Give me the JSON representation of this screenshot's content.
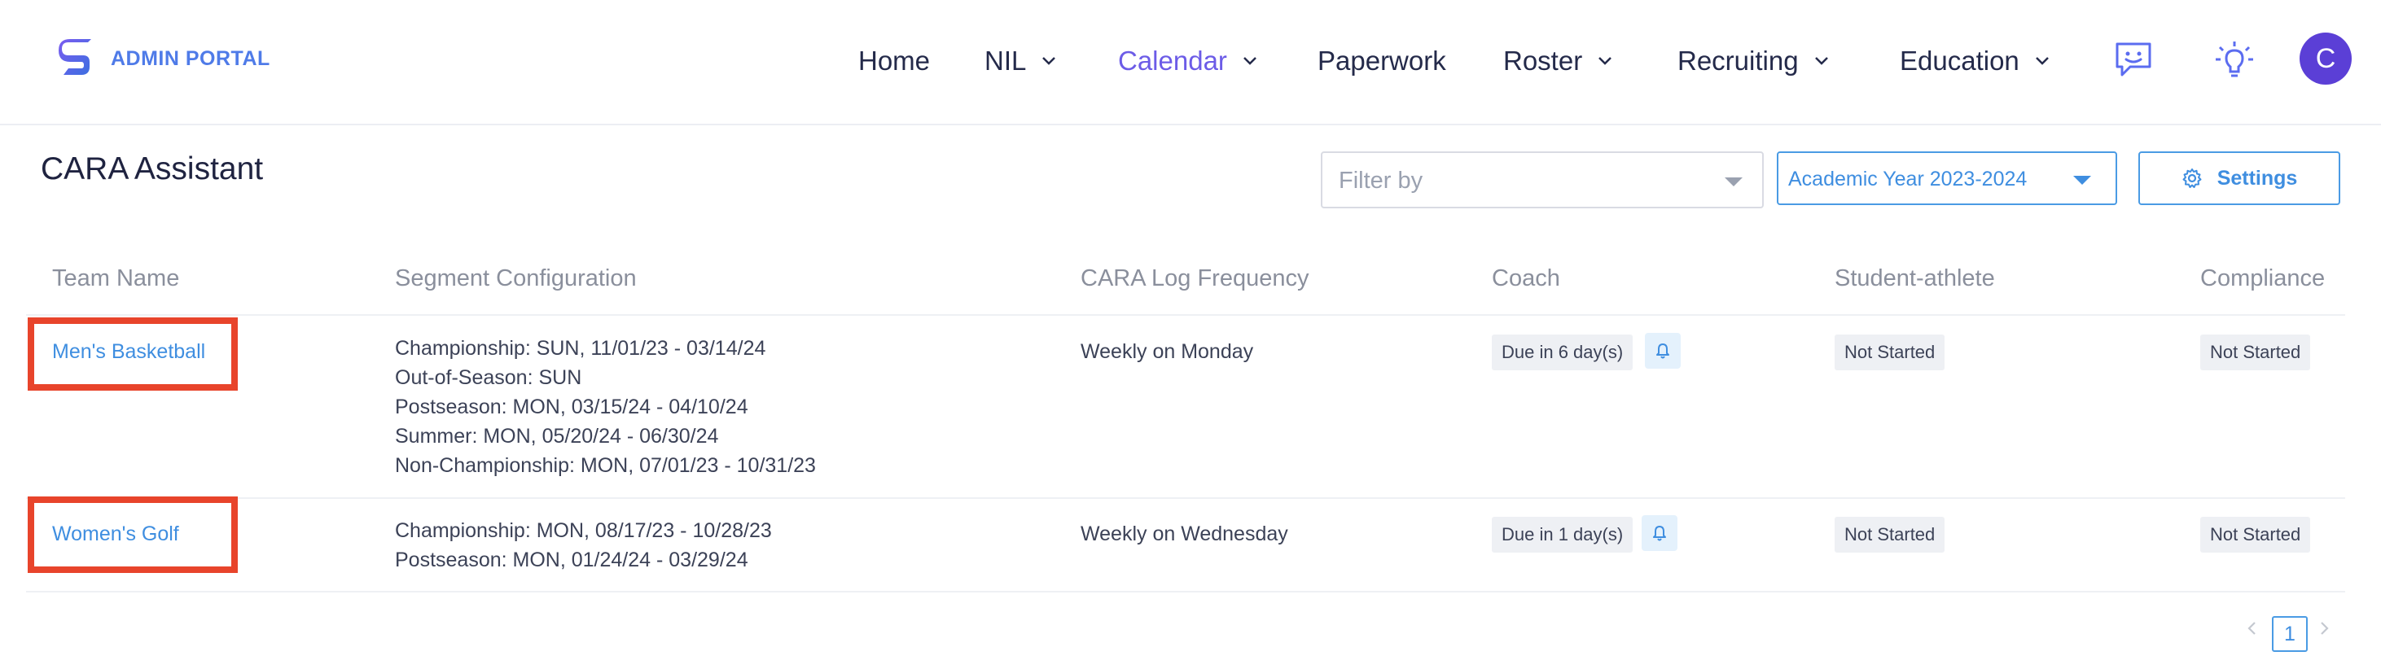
{
  "brand": {
    "name": "ADMIN PORTAL"
  },
  "nav": {
    "items": [
      {
        "label": "Home"
      },
      {
        "label": "NIL"
      },
      {
        "label": "Calendar"
      },
      {
        "label": "Paperwork"
      },
      {
        "label": "Roster"
      },
      {
        "label": "Recruiting"
      },
      {
        "label": "Education"
      }
    ],
    "active": "Calendar"
  },
  "user": {
    "avatar_initial": "C"
  },
  "page": {
    "title": "CARA Assistant"
  },
  "controls": {
    "filter_placeholder": "Filter by",
    "academic_year": "Academic Year 2023-2024",
    "settings_label": "Settings"
  },
  "table": {
    "headers": [
      "Team Name",
      "Segment Configuration",
      "CARA Log Frequency",
      "Coach",
      "Student-athlete",
      "Compliance"
    ],
    "rows": [
      {
        "team": "Men's Basketball",
        "segments": [
          "Championship: SUN, 11/01/23 - 03/14/24",
          "Out-of-Season: SUN",
          "Postseason: MON, 03/15/24 - 04/10/24",
          "Summer: MON, 05/20/24 - 06/30/24",
          "Non-Championship: MON, 07/01/23 - 10/31/23"
        ],
        "frequency": "Weekly on Monday",
        "coach": "Due in 6 day(s)",
        "student_athlete": "Not Started",
        "compliance": "Not Started"
      },
      {
        "team": "Women's Golf",
        "segments": [
          "Championship: MON, 08/17/23 - 10/28/23",
          "Postseason: MON, 01/24/24 - 03/29/24"
        ],
        "frequency": "Weekly on Wednesday",
        "coach": "Due in 1 day(s)",
        "student_athlete": "Not Started",
        "compliance": "Not Started"
      }
    ]
  },
  "pagination": {
    "current": "1"
  },
  "colors": {
    "accent": "#3f8ee0",
    "active_nav": "#6c5ce7",
    "highlight": "#e8442b",
    "avatar_bg": "#5b3fd6"
  },
  "icons": [
    "logo-icon",
    "chevron-down-icon",
    "chat-icon",
    "lightbulb-icon",
    "gear-icon",
    "bell-icon",
    "chevron-left-icon",
    "chevron-right-icon"
  ]
}
